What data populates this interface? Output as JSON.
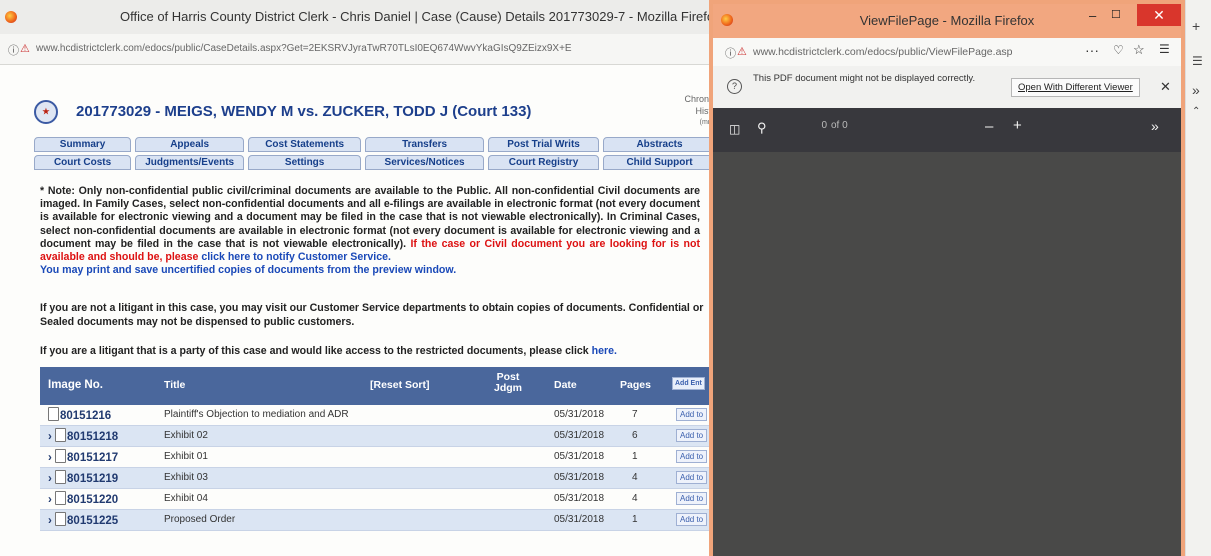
{
  "browser_main": {
    "title": "Office of Harris County District Clerk - Chris Daniel | Case (Cause) Details 201773029-7 - Mozilla Firefox",
    "url": "www.hcdistrictclerk.com/edocs/public/CaseDetails.aspx?Get=2EKSRVJyraTwR70TLsI0EQ674WwvYkaGIsQ9ZEizx9X+E"
  },
  "case": {
    "title": "201773029 - MEIGS, WENDY M vs. ZUCKER, TODD J (Court 133)",
    "side_links": [
      "Chronol",
      "Histo",
      "(mm-"
    ]
  },
  "tabs": {
    "row1": [
      "Summary",
      "Appeals",
      "Cost Statements",
      "Transfers",
      "Post Trial Writs",
      "Abstracts"
    ],
    "row2": [
      "Court Costs",
      "Judgments/Events",
      "Settings",
      "Services/Notices",
      "Court Registry",
      "Child Support"
    ]
  },
  "notice": {
    "body": "* Note: Only non-confidential public civil/criminal documents are available to the Public. All non-confidential Civil documents are imaged. In Family Cases, select non-confidential documents and all e-filings are available in electronic format (not every document is available for electronic viewing and a document may be filed in the case that is not viewable electronically). In Criminal Cases, select non-confidential documents are available in electronic format (not every document is available for electronic viewing and a document may be filed in the case that is not viewable electronically).",
    "red": "If the case or Civil document you are looking for is not available and should be, please",
    "link": "click here to notify",
    "red2": "Customer Service.",
    "print": "You may print and save uncertified copies of documents from the preview window.",
    "non_litigant": "If you are not a litigant in this case, you may visit our Customer Service departments to obtain copies of documents. Confidential or Sealed documents may not be dispensed to public customers.",
    "litigant": "If you are a litigant that is a party of this case and would like access to the restricted documents, please click",
    "litigant_link": "here."
  },
  "table": {
    "headers": {
      "image": "Image No.",
      "title": "Title",
      "reset": "[Reset Sort]",
      "post": "Post Jdgm",
      "date": "Date",
      "pages": "Pages",
      "add": "Add Ent"
    },
    "rows": [
      {
        "image": "80151216",
        "title": "Plaintiff's Objection to mediation and ADR",
        "date": "05/31/2018",
        "pages": "7",
        "add": "Add to"
      },
      {
        "image": "80151218",
        "title": "Exhibit 02",
        "date": "05/31/2018",
        "pages": "6",
        "add": "Add to"
      },
      {
        "image": "80151217",
        "title": "Exhibit 01",
        "date": "05/31/2018",
        "pages": "1",
        "add": "Add to"
      },
      {
        "image": "80151219",
        "title": "Exhibit 03",
        "date": "05/31/2018",
        "pages": "4",
        "add": "Add to"
      },
      {
        "image": "80151220",
        "title": "Exhibit 04",
        "date": "05/31/2018",
        "pages": "4",
        "add": "Add to"
      },
      {
        "image": "80151225",
        "title": "Proposed Order",
        "date": "05/31/2018",
        "pages": "1",
        "add": "Add to"
      }
    ]
  },
  "viewer": {
    "title": "ViewFilePage - Mozilla Firefox",
    "url": "www.hcdistrictclerk.com/edocs/public/ViewFilePage.asp",
    "message": "This PDF document might not be displayed correctly.",
    "button": "Open With Different Viewer",
    "page_value": "0",
    "page_total": "of 0"
  }
}
